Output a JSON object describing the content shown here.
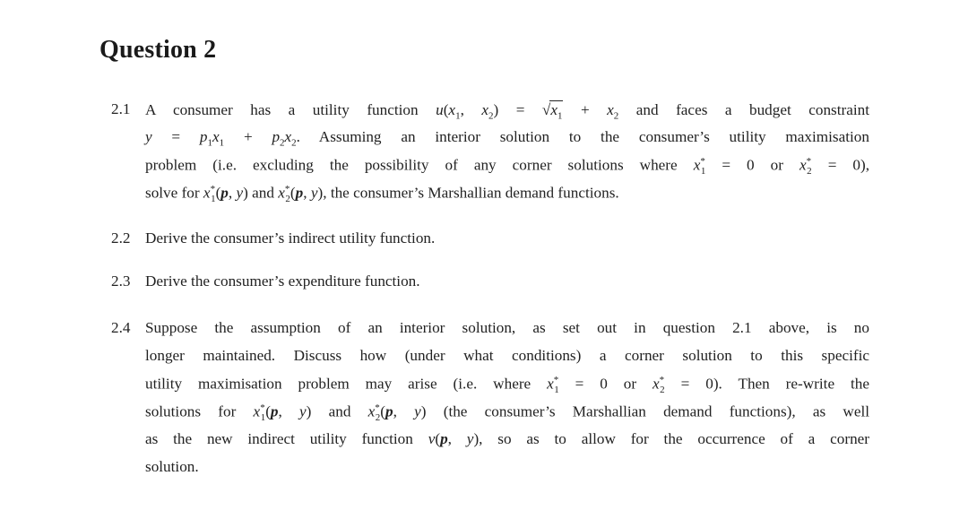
{
  "title": "Question 2",
  "questions": [
    {
      "number": "2.1",
      "lines": [
        "A consumer has a utility function u(x1, x2) = √x1 + x2 and faces a budget constraint",
        "y = p1x1 + p2x2. Assuming an interior solution to the consumer's utility maximisation",
        "problem (i.e. excluding the possibility of any corner solutions where x1* = 0 or x2* = 0),",
        "solve for x1*(p, y) and x2*(p, y), the consumer's Marshallian demand functions."
      ],
      "parts": {
        "l1a": "A consumer has a utility function",
        "l1b": "and faces a budget constraint",
        "l2b": ". Assuming an interior solution to the consumer’s utility maximisation",
        "l3a": "problem (i.e.  excluding the possibility of any corner solutions where",
        "l3or": "or",
        "l3end": "),",
        "l4a": "solve for",
        "l4and": "and",
        "l4end": ", the consumer’s Marshallian demand functions."
      }
    },
    {
      "number": "2.2",
      "text": "Derive the consumer’s indirect utility function."
    },
    {
      "number": "2.3",
      "text": "Derive the consumer’s expenditure function."
    },
    {
      "number": "2.4",
      "parts": {
        "l1": "Suppose the assumption of an interior solution, as set out in question 2.1 above, is no",
        "l2": "longer maintained. Discuss how (under what conditions) a corner solution to this specific",
        "l3a": "utility maximisation problem may arise (i.e.  where",
        "l3or": "or",
        "l3end": ").  Then re-write the",
        "l4a": "solutions for",
        "l4and": "and",
        "l4end": "(the consumer’s Marshallian demand functions), as well",
        "l5a": "as the new indirect utility function",
        "l5end": ", so as to allow for the occurrence of a corner",
        "l6": "solution."
      }
    }
  ]
}
